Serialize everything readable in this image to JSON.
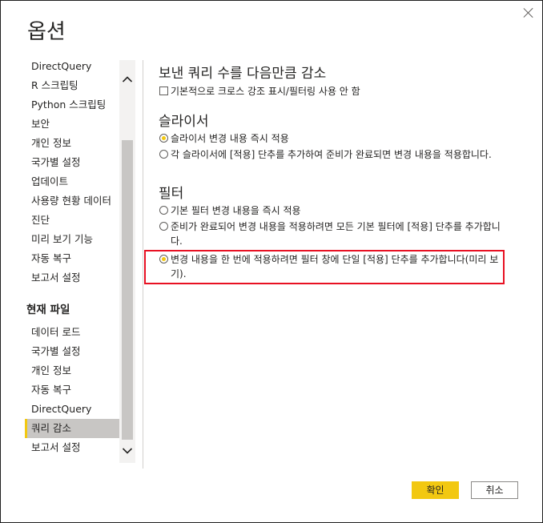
{
  "dialog": {
    "title": "옵션",
    "close_icon": "close-icon"
  },
  "sidebar": {
    "global_items": [
      {
        "label": "DirectQuery"
      },
      {
        "label": "R 스크립팅"
      },
      {
        "label": "Python 스크립팅"
      },
      {
        "label": "보안"
      },
      {
        "label": "개인 정보"
      },
      {
        "label": "국가별 설정"
      },
      {
        "label": "업데이트"
      },
      {
        "label": "사용량 현황 데이터"
      },
      {
        "label": "진단"
      },
      {
        "label": "미리 보기 기능"
      },
      {
        "label": "자동 복구"
      },
      {
        "label": "보고서 설정"
      }
    ],
    "section_header": "현재 파일",
    "file_items": [
      {
        "label": "데이터 로드"
      },
      {
        "label": "국가별 설정"
      },
      {
        "label": "개인 정보"
      },
      {
        "label": "자동 복구"
      },
      {
        "label": "DirectQuery"
      },
      {
        "label": "쿼리 감소",
        "selected": true
      },
      {
        "label": "보고서 설정"
      }
    ],
    "scroll_up_icon": "chevron-up-icon",
    "scroll_down_icon": "chevron-down-icon"
  },
  "main": {
    "heading": "보낸 쿼리 수를 다음만큼 감소",
    "checkbox_label": "기본적으로 크로스 강조 표시/필터링 사용 안 함",
    "checkbox_checked": false,
    "slicer": {
      "heading": "슬라이서",
      "options": [
        {
          "label": "슬라이서 변경 내용 즉시 적용",
          "selected": true
        },
        {
          "label": "각 슬라이서에 [적용] 단추를 추가하여 준비가 완료되면 변경 내용을 적용합니다.",
          "selected": false
        }
      ]
    },
    "filter": {
      "heading": "필터",
      "options": [
        {
          "label": "기본 필터 변경 내용을 즉시 적용",
          "selected": false
        },
        {
          "label": "준비가 완료되어 변경 내용을 적용하려면 모든 기본 필터에 [적용] 단추를 추가합니다.",
          "selected": false
        },
        {
          "label": "변경 내용을 한 번에 적용하려면 필터 창에 단일 [적용] 단추를 추가합니다(미리 보기).",
          "selected": true
        }
      ]
    },
    "highlight_color": "#e81123"
  },
  "footer": {
    "ok_label": "확인",
    "cancel_label": "취소"
  },
  "colors": {
    "accent": "#f2c811",
    "selected_nav": "#c8c6c4"
  }
}
